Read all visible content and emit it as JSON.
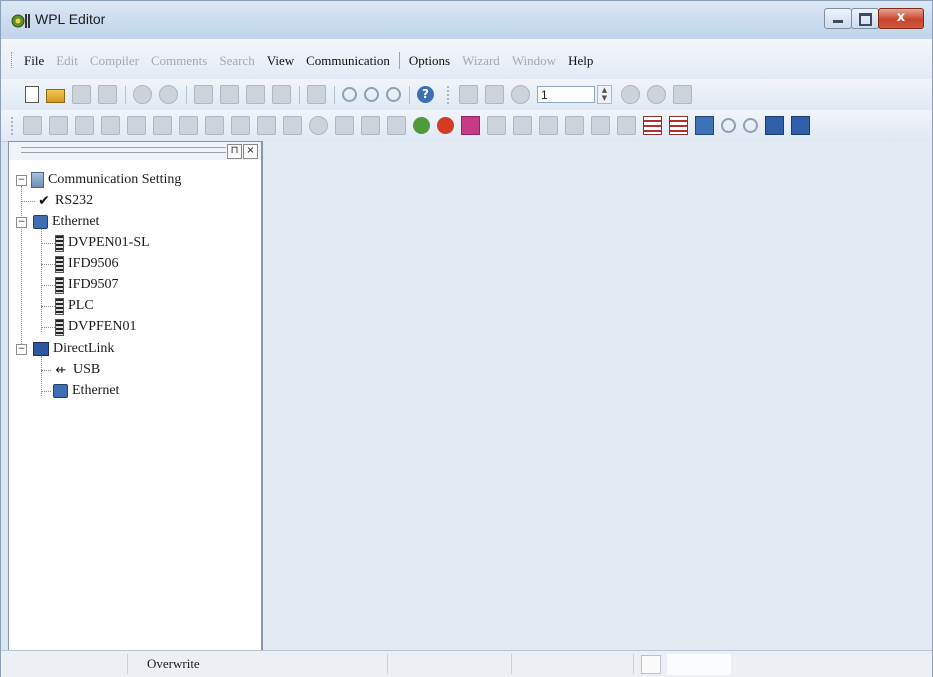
{
  "window": {
    "title": "WPL Editor",
    "close_glyph": "x"
  },
  "menu": {
    "items": [
      {
        "label": "File",
        "enabled": true
      },
      {
        "label": "Edit",
        "enabled": false
      },
      {
        "label": "Compiler",
        "enabled": false
      },
      {
        "label": "Comments",
        "enabled": false
      },
      {
        "label": "Search",
        "enabled": false
      },
      {
        "label": "View",
        "enabled": true
      },
      {
        "label": "Communication",
        "enabled": true
      },
      {
        "label": "Options",
        "enabled": true
      },
      {
        "label": "Wizard",
        "enabled": false
      },
      {
        "label": "Window",
        "enabled": false
      },
      {
        "label": "Help",
        "enabled": true
      }
    ]
  },
  "toolbar": {
    "step_value": "1"
  },
  "panel": {
    "pin_glyph": "⊓",
    "close_glyph": "×"
  },
  "tree": {
    "root": "Communication Setting",
    "rs232": "RS232",
    "ethernet": "Ethernet",
    "devices": [
      "DVPEN01-SL",
      "IFD9506",
      "IFD9507",
      "PLC",
      "DVPFEN01"
    ],
    "directlink": "DirectLink",
    "usb": "USB",
    "direct_ethernet": "Ethernet"
  },
  "status": {
    "mode": "Overwrite"
  },
  "colors": {
    "workspace": "#e4eaf1",
    "titlebar": "#cbdcef",
    "disabled_text": "#a3a9b2"
  }
}
